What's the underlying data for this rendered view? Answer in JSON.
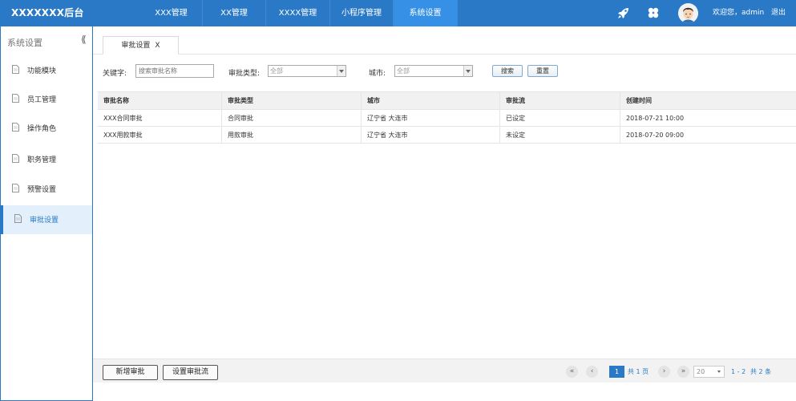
{
  "app": {
    "brand": "XXXXXXX后台"
  },
  "nav": {
    "items": [
      "XXX管理",
      "XX管理",
      "XXXX管理",
      "小程序管理",
      "系统设置"
    ],
    "active_index": 4
  },
  "header_right": {
    "welcome": "欢迎您，admin",
    "logout": "退出",
    "icons": [
      "rocket-icon",
      "clover-icon",
      "avatar"
    ]
  },
  "sidebar": {
    "title": "系统设置",
    "collapse": "《",
    "items": [
      "功能模块",
      "员工管理",
      "操作角色",
      "职务管理",
      "预警设置",
      "审批设置"
    ],
    "active_index": 5
  },
  "tab": {
    "label": "审批设置",
    "close": "X"
  },
  "filters": {
    "keyword_label": "关键字:",
    "keyword_placeholder": "搜索审批名称",
    "type_label": "审批类型:",
    "type_value": "全部",
    "city_label": "城市:",
    "city_value": "全部",
    "search_label": "搜索",
    "reset_label": "重置"
  },
  "table": {
    "headers": [
      "审批名称",
      "审批类型",
      "城市",
      "审批流",
      "创建时间"
    ],
    "rows": [
      [
        "XXX合同审批",
        "合同审批",
        "辽宁省  大连市",
        "已设定",
        "2018-07-21 10:00"
      ],
      [
        "XXX用款审批",
        "用款审批",
        "辽宁省  大连市",
        "未设定",
        "2018-07-20 09:00"
      ]
    ]
  },
  "footer": {
    "add_label": "新增审批",
    "flow_label": "设置审批流",
    "first": "«",
    "prev": "‹",
    "page": "1",
    "total_pages": "共 1 页",
    "next": "›",
    "last": "»",
    "page_size": "20",
    "range": "1 - 2",
    "total": "共 2 条"
  },
  "colors": {
    "accent": "#2a79c7",
    "nav_active": "#3691e6"
  }
}
